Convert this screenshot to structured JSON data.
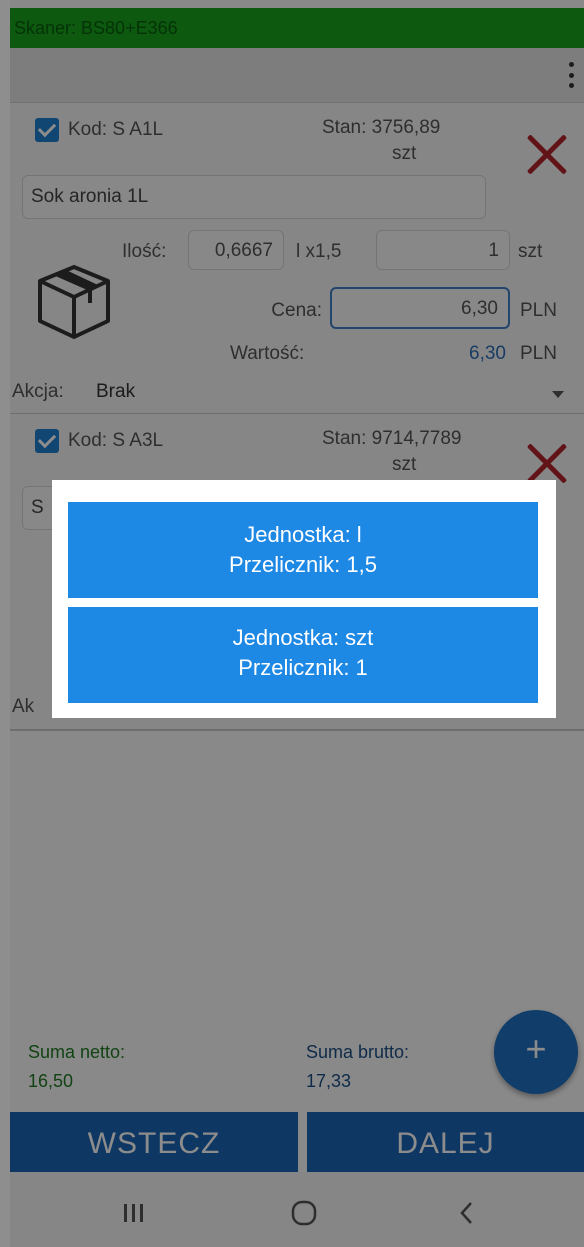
{
  "scanner": {
    "label": "Skaner: BS80+E366"
  },
  "colors": {
    "scanner_green": "#17a21c",
    "accent_blue": "#1e88e5",
    "button_blue": "#1b65b5",
    "delete_red": "#b3232a"
  },
  "items": [
    {
      "kod": "Kod: S A1L",
      "stan_label": "Stan: 3756,89",
      "stan_unit": "szt",
      "name": "Sok aronia 1L",
      "ilosc_label": "Ilość:",
      "ilosc_value": "0,6667",
      "unit_conv": "l x1,5",
      "qty_value": "1",
      "qty_unit": "szt",
      "cena_label": "Cena:",
      "cena_value": "6,30",
      "cena_currency": "PLN",
      "wartosc_label": "Wartość:",
      "wartosc_value": "6,30",
      "wartosc_currency": "PLN",
      "akcja_label": "Akcja:",
      "akcja_value": "Brak"
    },
    {
      "kod": "Kod: S A3L",
      "stan_label": "Stan: 9714,7789",
      "stan_unit": "szt",
      "name_partial": "S",
      "akcja_partial": "Ak"
    }
  ],
  "dialog": {
    "options": [
      {
        "line1": "Jednostka: l",
        "line2": "Przelicznik: 1,5"
      },
      {
        "line1": "Jednostka: szt",
        "line2": "Przelicznik: 1"
      }
    ]
  },
  "footer": {
    "netto_label": "Suma netto:",
    "netto_value": "16,50",
    "brutto_label": "Suma brutto:",
    "brutto_value": "17,33",
    "fab_label": "+",
    "back_label": "WSTECZ",
    "next_label": "DALEJ"
  },
  "navbar": {
    "recents_icon": "recents-icon",
    "home_icon": "home-icon",
    "back_icon": "back-icon"
  }
}
